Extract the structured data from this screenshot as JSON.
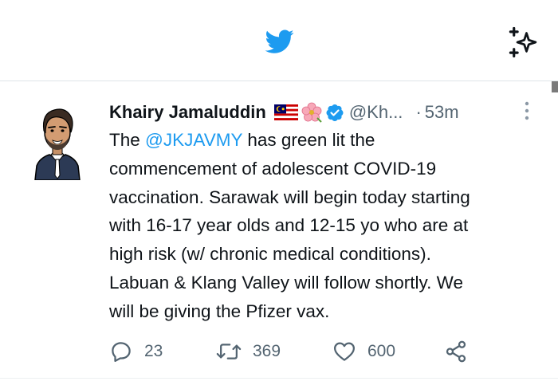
{
  "header": {
    "logo_icon": "twitter-bird-icon",
    "sparkle_icon": "sparkle-icon",
    "brand_color": "#1d9bf0"
  },
  "tweet": {
    "author_name": "Khairy Jamaluddin",
    "emoji_flag": "malaysia-flag",
    "emoji_flower": "hibiscus-flower",
    "verified_icon": "verified-badge-icon",
    "handle": "@Kh...",
    "separator": "·",
    "time": "53m",
    "text_before_mention": "The ",
    "mention": "@JKJAVMY",
    "text_after_mention": " has green lit the\ncommencement of adolescent COVID-19\nvaccination. Sarawak will begin today starting\nwith 16-17 year olds and 12-15 yo who are at\nhigh risk (w/ chronic medical conditions).\nLabuan & Klang Valley will follow shortly. We\nwill be giving the Pfizer vax.",
    "actions": {
      "reply_count": "23",
      "retweet_count": "369",
      "like_count": "600"
    }
  }
}
